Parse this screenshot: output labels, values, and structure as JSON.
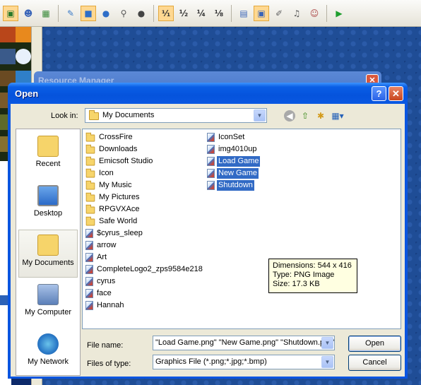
{
  "editor": {
    "toolbar": {
      "buttons": [
        "select-icon",
        "map-icon",
        "event-icon",
        "database-icon",
        "pencil-icon",
        "rectangle-icon",
        "ellipse-icon",
        "fill-icon",
        "shadow-pen-icon",
        "zoom-1-1",
        "zoom-1-2",
        "zoom-1-4",
        "zoom-1-8",
        "script-editor-icon",
        "resource-manager-icon",
        "sound-test-icon",
        "character-icon",
        "playtest-icon"
      ],
      "zoom": {
        "z1": "¹⁄₁",
        "z2": "½",
        "z4": "¼",
        "z8": "⅛"
      }
    },
    "resource_manager": {
      "title": "Resource Manager",
      "close": "✕"
    }
  },
  "dialog": {
    "title": "Open",
    "help_label": "?",
    "close_label": "✕",
    "look_in_label": "Look in:",
    "look_in_value": "My Documents",
    "places": [
      {
        "label": "Recent"
      },
      {
        "label": "Desktop"
      },
      {
        "label": "My Documents"
      },
      {
        "label": "My Computer"
      },
      {
        "label": "My Network"
      }
    ],
    "files_col1": [
      {
        "name": "CrossFire",
        "kind": "folder"
      },
      {
        "name": "Downloads",
        "kind": "folder"
      },
      {
        "name": "Emicsoft Studio",
        "kind": "folder"
      },
      {
        "name": "Icon",
        "kind": "folder"
      },
      {
        "name": "My Music",
        "kind": "folder"
      },
      {
        "name": "My Pictures",
        "kind": "folder"
      },
      {
        "name": "RPGVXAce",
        "kind": "folder"
      },
      {
        "name": "Safe World",
        "kind": "folder"
      },
      {
        "name": "$cyrus_sleep",
        "kind": "png"
      },
      {
        "name": "arrow",
        "kind": "png"
      },
      {
        "name": "Art",
        "kind": "png"
      },
      {
        "name": "CompleteLogo2_zps9584e218",
        "kind": "png"
      },
      {
        "name": "cyrus",
        "kind": "png"
      },
      {
        "name": "face",
        "kind": "png"
      },
      {
        "name": "Hannah",
        "kind": "png"
      }
    ],
    "files_col2": [
      {
        "name": "IconSet",
        "kind": "png",
        "selected": false
      },
      {
        "name": "img4010up",
        "kind": "png",
        "selected": false
      },
      {
        "name": "Load Game",
        "kind": "png",
        "selected": true
      },
      {
        "name": "New Game",
        "kind": "png",
        "selected": true
      },
      {
        "name": "Shutdown",
        "kind": "png",
        "selected": true
      }
    ],
    "tooltip": {
      "dimensions": "Dimensions: 544 x 416",
      "type": "Type: PNG Image",
      "size": "Size: 17.3 KB"
    },
    "file_name_label": "File name:",
    "file_name_value": "\"Load Game.png\" \"New Game.png\" \"Shutdown.png\"",
    "files_of_type_label": "Files of type:",
    "files_of_type_value": "Graphics File (*.png;*.jpg;*.bmp)",
    "open_button": "Open",
    "cancel_button": "Cancel"
  }
}
